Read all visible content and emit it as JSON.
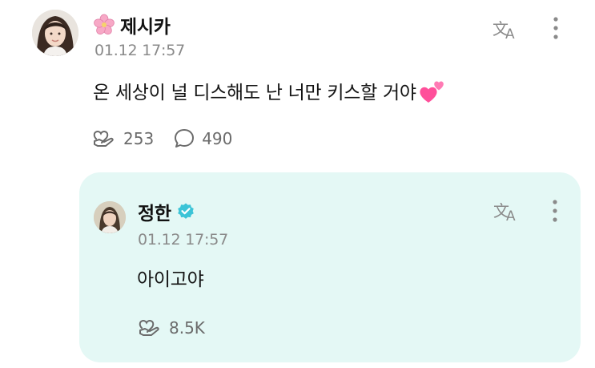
{
  "post": {
    "author": "제시카",
    "author_icon": "cherry-blossom-icon",
    "timestamp": "01.12 17:57",
    "message": "온 세상이 널 디스해도 난 너만 키스할 거야",
    "message_emoji": "two-hearts-icon",
    "reactions": "253",
    "comments": "490"
  },
  "reply": {
    "author": "정한",
    "verified_icon": "verified-badge-icon",
    "timestamp": "01.12 17:57",
    "message": "아이고야",
    "reactions": "8.5K"
  },
  "colors": {
    "reply_background": "#e4f8f5",
    "verified_badge": "#3cc4d7",
    "meta_text": "#8a8a8a",
    "hearts": "#ff4f9a"
  }
}
